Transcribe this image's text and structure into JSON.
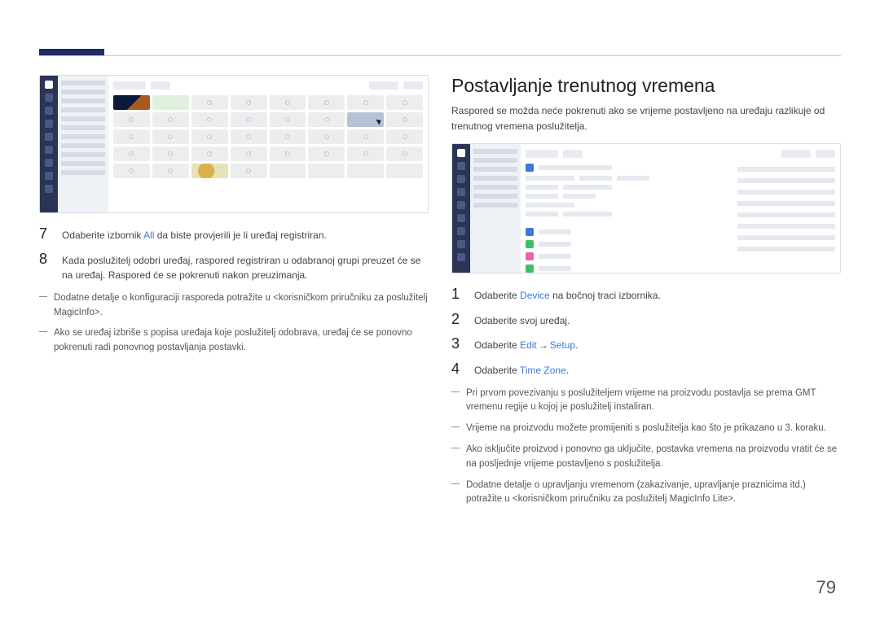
{
  "left": {
    "steps": [
      {
        "num": "7",
        "parts": [
          {
            "t": "Odaberite izbornik "
          },
          {
            "t": "All",
            "cls": "link-blue"
          },
          {
            "t": " da biste provjerili je li uređaj registriran."
          }
        ]
      },
      {
        "num": "8",
        "parts": [
          {
            "t": "Kada poslužitelj odobri uređaj, raspored registriran u odabranoj grupi preuzet će se na uređaj. Raspored će se pokrenuti nakon preuzimanja."
          }
        ]
      }
    ],
    "notes": [
      "Dodatne detalje o konfiguraciji rasporeda potražite u <korisničkom priručniku za poslužitelj MagicInfo>.",
      "Ako se uređaj izbriše s popisa uređaja koje poslužitelj odobrava, uređaj će se ponovno pokrenuti radi ponovnog postavljanja postavki."
    ]
  },
  "right": {
    "title": "Postavljanje trenutnog vremena",
    "intro": "Raspored se možda neće pokrenuti ako se vrijeme postavljeno na uređaju razlikuje od trenutnog vremena poslužitelja.",
    "steps": [
      {
        "num": "1",
        "parts": [
          {
            "t": "Odaberite "
          },
          {
            "t": "Device",
            "cls": "link-blue"
          },
          {
            "t": " na bočnoj traci izbornika."
          }
        ]
      },
      {
        "num": "2",
        "parts": [
          {
            "t": "Odaberite svoj uređaj."
          }
        ]
      },
      {
        "num": "3",
        "parts": [
          {
            "t": "Odaberite "
          },
          {
            "t": "Edit",
            "cls": "link-blue"
          },
          {
            "t": " → ",
            "cls": "arrow"
          },
          {
            "t": "Setup",
            "cls": "link-blue"
          },
          {
            "t": "."
          }
        ]
      },
      {
        "num": "4",
        "parts": [
          {
            "t": "Odaberite "
          },
          {
            "t": "Time Zone",
            "cls": "link-blue"
          },
          {
            "t": "."
          }
        ]
      }
    ],
    "notes": [
      "Pri prvom povezivanju s poslužiteljem vrijeme na proizvodu postavlja se prema GMT vremenu regije u kojoj je poslužitelj instaliran.",
      "Vrijeme na proizvodu možete promijeniti s poslužitelja kao što je prikazano u 3. koraku.",
      "Ako isključite proizvod i ponovno ga uključite, postavka vremena na proizvodu vratit će se na posljednje vrijeme postavljeno s poslužitelja.",
      "Dodatne detalje o upravljanju vremenom (zakazivanje, upravljanje praznicima itd.) potražite u <korisničkom priručniku za poslužitelj MagicInfo Lite>."
    ]
  },
  "pageNumber": "79"
}
